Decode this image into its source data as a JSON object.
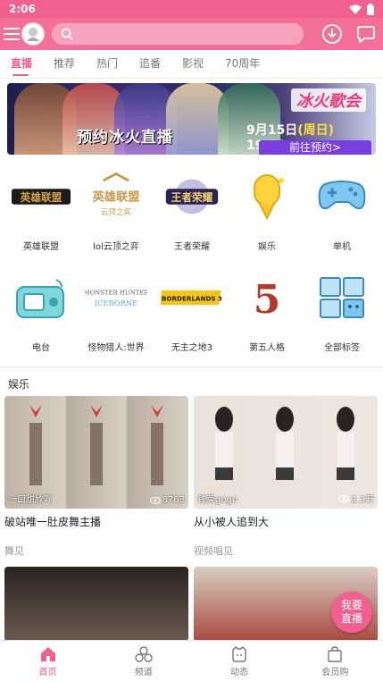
{
  "status_bar": {
    "time": "2:06"
  },
  "tabs": [
    {
      "label": "直播",
      "active": true
    },
    {
      "label": "推荐",
      "active": false
    },
    {
      "label": "热门",
      "active": false
    },
    {
      "label": "追番",
      "active": false
    },
    {
      "label": "影视",
      "active": false
    },
    {
      "label": "70周年",
      "active": false
    }
  ],
  "banner": {
    "title": "预约冰火直播",
    "brand": "冰火歌会",
    "date": "9月15日",
    "weekday": "(周日)",
    "time": "19:00",
    "reserve": "前往预约>"
  },
  "categories": [
    {
      "label": "英雄联盟",
      "icon": "lol-logo-icon"
    },
    {
      "label": "lol云顶之弈",
      "icon": "tft-logo-icon"
    },
    {
      "label": "王者荣耀",
      "icon": "honor-of-kings-logo-icon"
    },
    {
      "label": "娱乐",
      "icon": "microphone-icon"
    },
    {
      "label": "单机",
      "icon": "gamepad-icon"
    },
    {
      "label": "电台",
      "icon": "radio-icon"
    },
    {
      "label": "怪物猎人:世界",
      "icon": "monster-hunter-logo-icon"
    },
    {
      "label": "无主之地3",
      "icon": "borderlands-logo-icon"
    },
    {
      "label": "第五人格",
      "icon": "identity-v-logo-icon"
    },
    {
      "label": "全部标签",
      "icon": "all-tags-icon"
    }
  ],
  "category_logo_text": {
    "lol": "英雄联盟",
    "tft": "英雄联盟",
    "tft_sub": "云顶之弈",
    "hok": "王者荣耀",
    "mh": "MONSTER HUNTER",
    "mh_sub": "ICEBORNE",
    "bl": "BORDERLANDS 3",
    "idv": "5"
  },
  "section": {
    "title": "娱乐"
  },
  "cards": [
    {
      "streamer": "一口甜欣吖",
      "views": "8763",
      "title": "破站唯一肚皮舞主播",
      "tag": "舞见"
    },
    {
      "streamer": "钱莱gogo",
      "views": "2.3万",
      "title": "从小被人追到大",
      "tag": "视频唱见"
    }
  ],
  "live_button": {
    "line1": "我要",
    "line2": "直播"
  },
  "nav": [
    {
      "label": "首页",
      "icon": "home-icon",
      "active": true
    },
    {
      "label": "频道",
      "icon": "channel-icon",
      "active": false
    },
    {
      "label": "动态",
      "icon": "dynamic-icon",
      "active": false
    },
    {
      "label": "会员购",
      "icon": "shopping-bag-icon",
      "active": false
    }
  ],
  "colors": {
    "brand": "#f1608f",
    "top_bar": "#f37199",
    "search": "#f8a3bd"
  }
}
